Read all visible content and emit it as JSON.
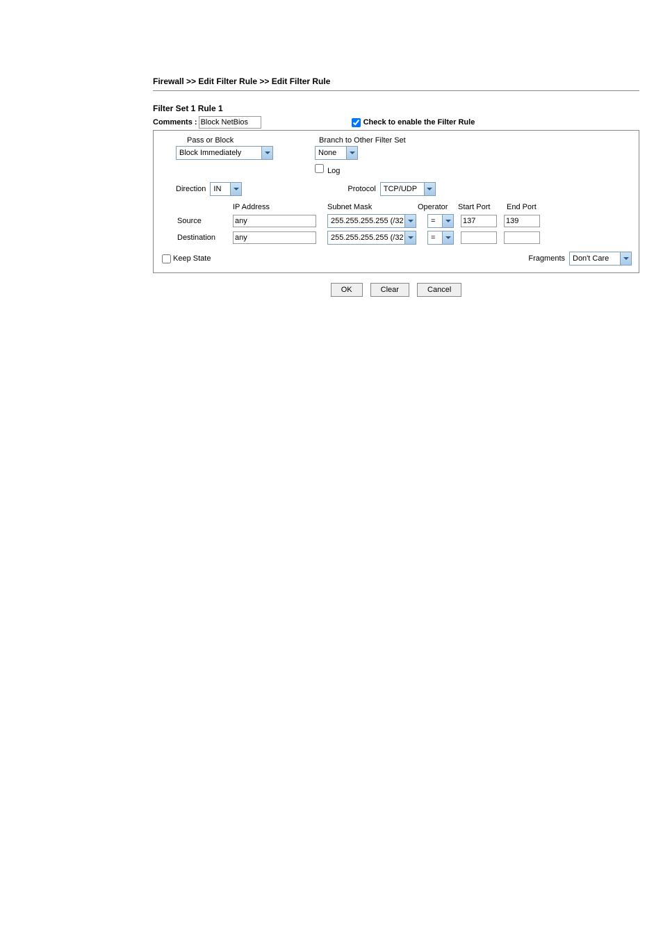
{
  "breadcrumb": "Firewall >> Edit Filter Rule >> Edit Filter Rule",
  "title": "Filter Set 1 Rule 1",
  "comments_label": "Comments :",
  "comments_value": "Block NetBios",
  "enable_checked": true,
  "enable_label": "Check to enable the Filter Rule",
  "passblock_label": "Pass or Block",
  "passblock_value": "Block Immediately",
  "branch_label": "Branch to Other Filter Set",
  "branch_value": "None",
  "log_label": "Log",
  "direction_label": "Direction",
  "direction_value": "IN",
  "protocol_label": "Protocol",
  "protocol_value": "TCP/UDP",
  "headers": {
    "ip": "IP Address",
    "mask": "Subnet Mask",
    "op": "Operator",
    "start": "Start Port",
    "end": "End Port"
  },
  "source": {
    "label": "Source",
    "ip": "any",
    "mask": "255.255.255.255 (/32)",
    "op": "=",
    "start": "137",
    "end": "139"
  },
  "dest": {
    "label": "Destination",
    "ip": "any",
    "mask": "255.255.255.255 (/32)",
    "op": "=",
    "start": "",
    "end": ""
  },
  "keepstate_label": "Keep State",
  "fragments_label": "Fragments",
  "fragments_value": "Don't Care",
  "buttons": {
    "ok": "OK",
    "clear": "Clear",
    "cancel": "Cancel"
  }
}
